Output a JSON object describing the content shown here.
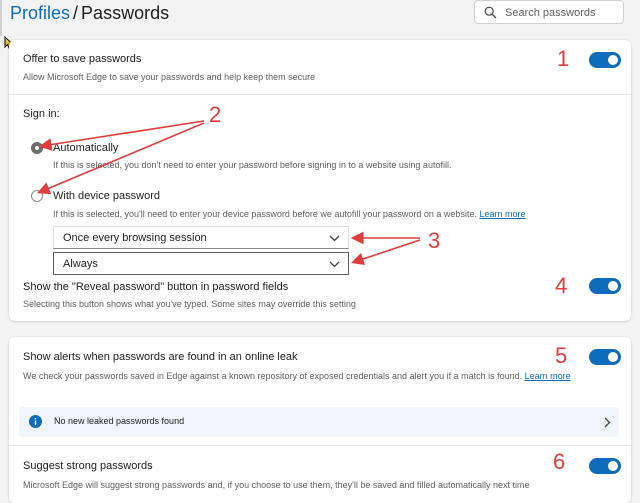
{
  "breadcrumb": {
    "parent": "Profiles",
    "separator": "/",
    "current": "Passwords"
  },
  "search": {
    "placeholder": "Search passwords"
  },
  "offer_save": {
    "title": "Offer to save passwords",
    "description": "Allow Microsoft Edge to save your passwords and help keep them secure",
    "enabled": true
  },
  "sign_in": {
    "heading": "Sign in:",
    "options": [
      {
        "label": "Automatically",
        "description": "If this is selected, you don't need to enter your password before signing in to a website using autofill.",
        "selected": true
      },
      {
        "label": "With device password",
        "description": "If this is selected, you'll need to enter your device password before we autofill your password on a website.",
        "link": "Learn more",
        "selected": false
      }
    ],
    "frequency_select": "Once every browsing session",
    "always_select": "Always"
  },
  "reveal": {
    "title": "Show the \"Reveal password\" button in password fields",
    "description": "Selecting this button shows what you've typed. Some sites may override this setting",
    "enabled": true
  },
  "leak_alerts": {
    "title": "Show alerts when passwords are found in an online leak",
    "description": "We check your passwords saved in Edge against a known repository of exposed credentials and alert you if a match is found.",
    "link": "Learn more",
    "enabled": true,
    "banner": "No new leaked passwords found"
  },
  "strong_pw": {
    "title": "Suggest strong passwords",
    "description": "Microsoft Edge will suggest strong passwords and, if you choose to use them, they'll be saved and filled automatically next time",
    "enabled": true
  },
  "annotations": [
    "1",
    "2",
    "3",
    "4",
    "5",
    "6"
  ],
  "colors": {
    "accent": "#0f6cbd",
    "annotation": "#e03c3c",
    "banner_bg": "#f0f6fc"
  }
}
